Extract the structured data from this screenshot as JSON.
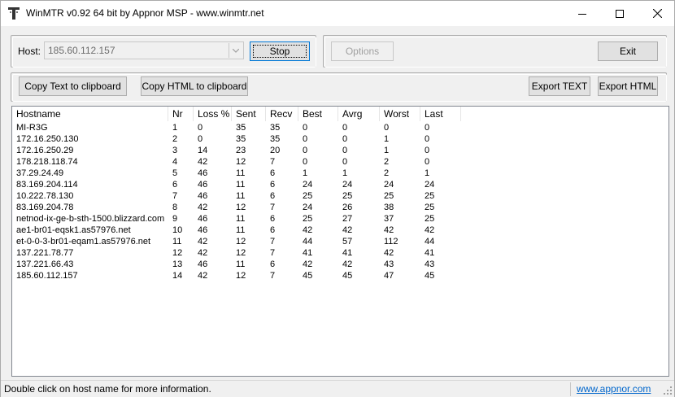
{
  "window": {
    "title": "WinMTR v0.92 64 bit by Appnor MSP - www.winmtr.net"
  },
  "host": {
    "label": "Host:",
    "value": "185.60.112.157"
  },
  "buttons": {
    "stop": "Stop",
    "options": "Options",
    "exit": "Exit",
    "copy_text": "Copy Text to clipboard",
    "copy_html": "Copy HTML to clipboard",
    "export_text": "Export TEXT",
    "export_html": "Export HTML"
  },
  "table": {
    "columns": [
      "Hostname",
      "Nr",
      "Loss %",
      "Sent",
      "Recv",
      "Best",
      "Avrg",
      "Worst",
      "Last"
    ],
    "rows": [
      [
        "MI-R3G",
        "1",
        "0",
        "35",
        "35",
        "0",
        "0",
        "0",
        "0"
      ],
      [
        "172.16.250.130",
        "2",
        "0",
        "35",
        "35",
        "0",
        "0",
        "1",
        "0"
      ],
      [
        "172.16.250.29",
        "3",
        "14",
        "23",
        "20",
        "0",
        "0",
        "1",
        "0"
      ],
      [
        "178.218.118.74",
        "4",
        "42",
        "12",
        "7",
        "0",
        "0",
        "2",
        "0"
      ],
      [
        "37.29.24.49",
        "5",
        "46",
        "11",
        "6",
        "1",
        "1",
        "2",
        "1"
      ],
      [
        "83.169.204.114",
        "6",
        "46",
        "11",
        "6",
        "24",
        "24",
        "24",
        "24"
      ],
      [
        "10.222.78.130",
        "7",
        "46",
        "11",
        "6",
        "25",
        "25",
        "25",
        "25"
      ],
      [
        "83.169.204.78",
        "8",
        "42",
        "12",
        "7",
        "24",
        "26",
        "38",
        "25"
      ],
      [
        "netnod-ix-ge-b-sth-1500.blizzard.com",
        "9",
        "46",
        "11",
        "6",
        "25",
        "27",
        "37",
        "25"
      ],
      [
        "ae1-br01-eqsk1.as57976.net",
        "10",
        "46",
        "11",
        "6",
        "42",
        "42",
        "42",
        "42"
      ],
      [
        "et-0-0-3-br01-eqam1.as57976.net",
        "11",
        "42",
        "12",
        "7",
        "44",
        "57",
        "112",
        "44"
      ],
      [
        "137.221.78.77",
        "12",
        "42",
        "12",
        "7",
        "41",
        "41",
        "42",
        "41"
      ],
      [
        "137.221.66.43",
        "13",
        "46",
        "11",
        "6",
        "42",
        "42",
        "43",
        "43"
      ],
      [
        "185.60.112.157",
        "14",
        "42",
        "12",
        "7",
        "45",
        "45",
        "47",
        "45"
      ]
    ]
  },
  "status": {
    "message": "Double click on host name for more information.",
    "link": "www.appnor.com"
  },
  "icons": {
    "app": "winmtr-icon",
    "minimize": "minimize-icon",
    "maximize": "maximize-icon",
    "close": "close-icon",
    "dropdown": "chevron-down-icon",
    "grip": "resize-grip-icon"
  }
}
